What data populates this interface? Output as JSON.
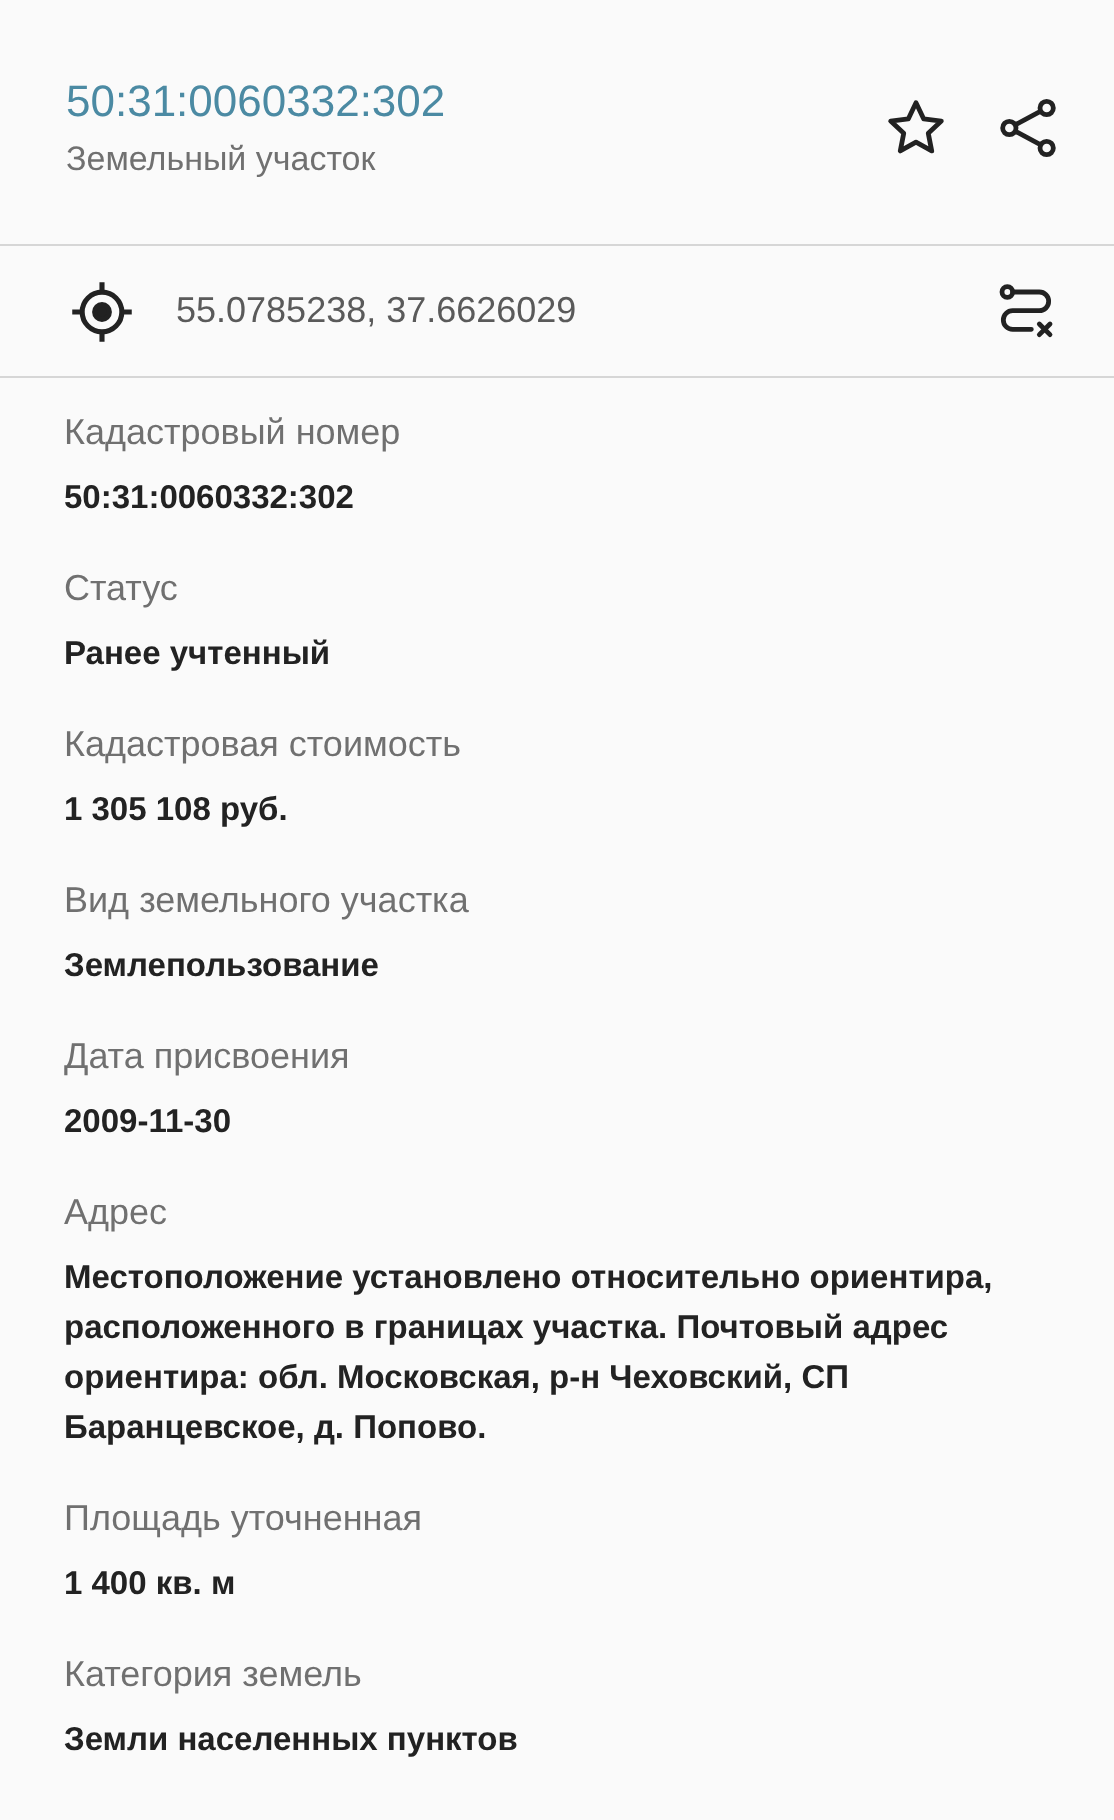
{
  "header": {
    "title": "50:31:0060332:302",
    "subtitle": "Земельный участок"
  },
  "location": {
    "coordinates": "55.0785238, 37.6626029"
  },
  "fields": [
    {
      "label": "Кадастровый номер",
      "value": "50:31:0060332:302"
    },
    {
      "label": "Статус",
      "value": "Ранее учтенный"
    },
    {
      "label": "Кадастровая стоимость",
      "value": "1 305 108 руб."
    },
    {
      "label": "Вид земельного участка",
      "value": "Землепользование"
    },
    {
      "label": "Дата присвоения",
      "value": "2009-11-30"
    },
    {
      "label": "Адрес",
      "value": "Местоположение установлено относительно ориентира, расположенного в границах участка. Почтовый адрес ориентира: обл. Московская, р-н Чеховский, СП Баранцевское, д. Попово."
    },
    {
      "label": "Площадь уточненная",
      "value": "1 400 кв. м"
    },
    {
      "label": "Категория земель",
      "value": "Земли населенных пунктов"
    }
  ]
}
